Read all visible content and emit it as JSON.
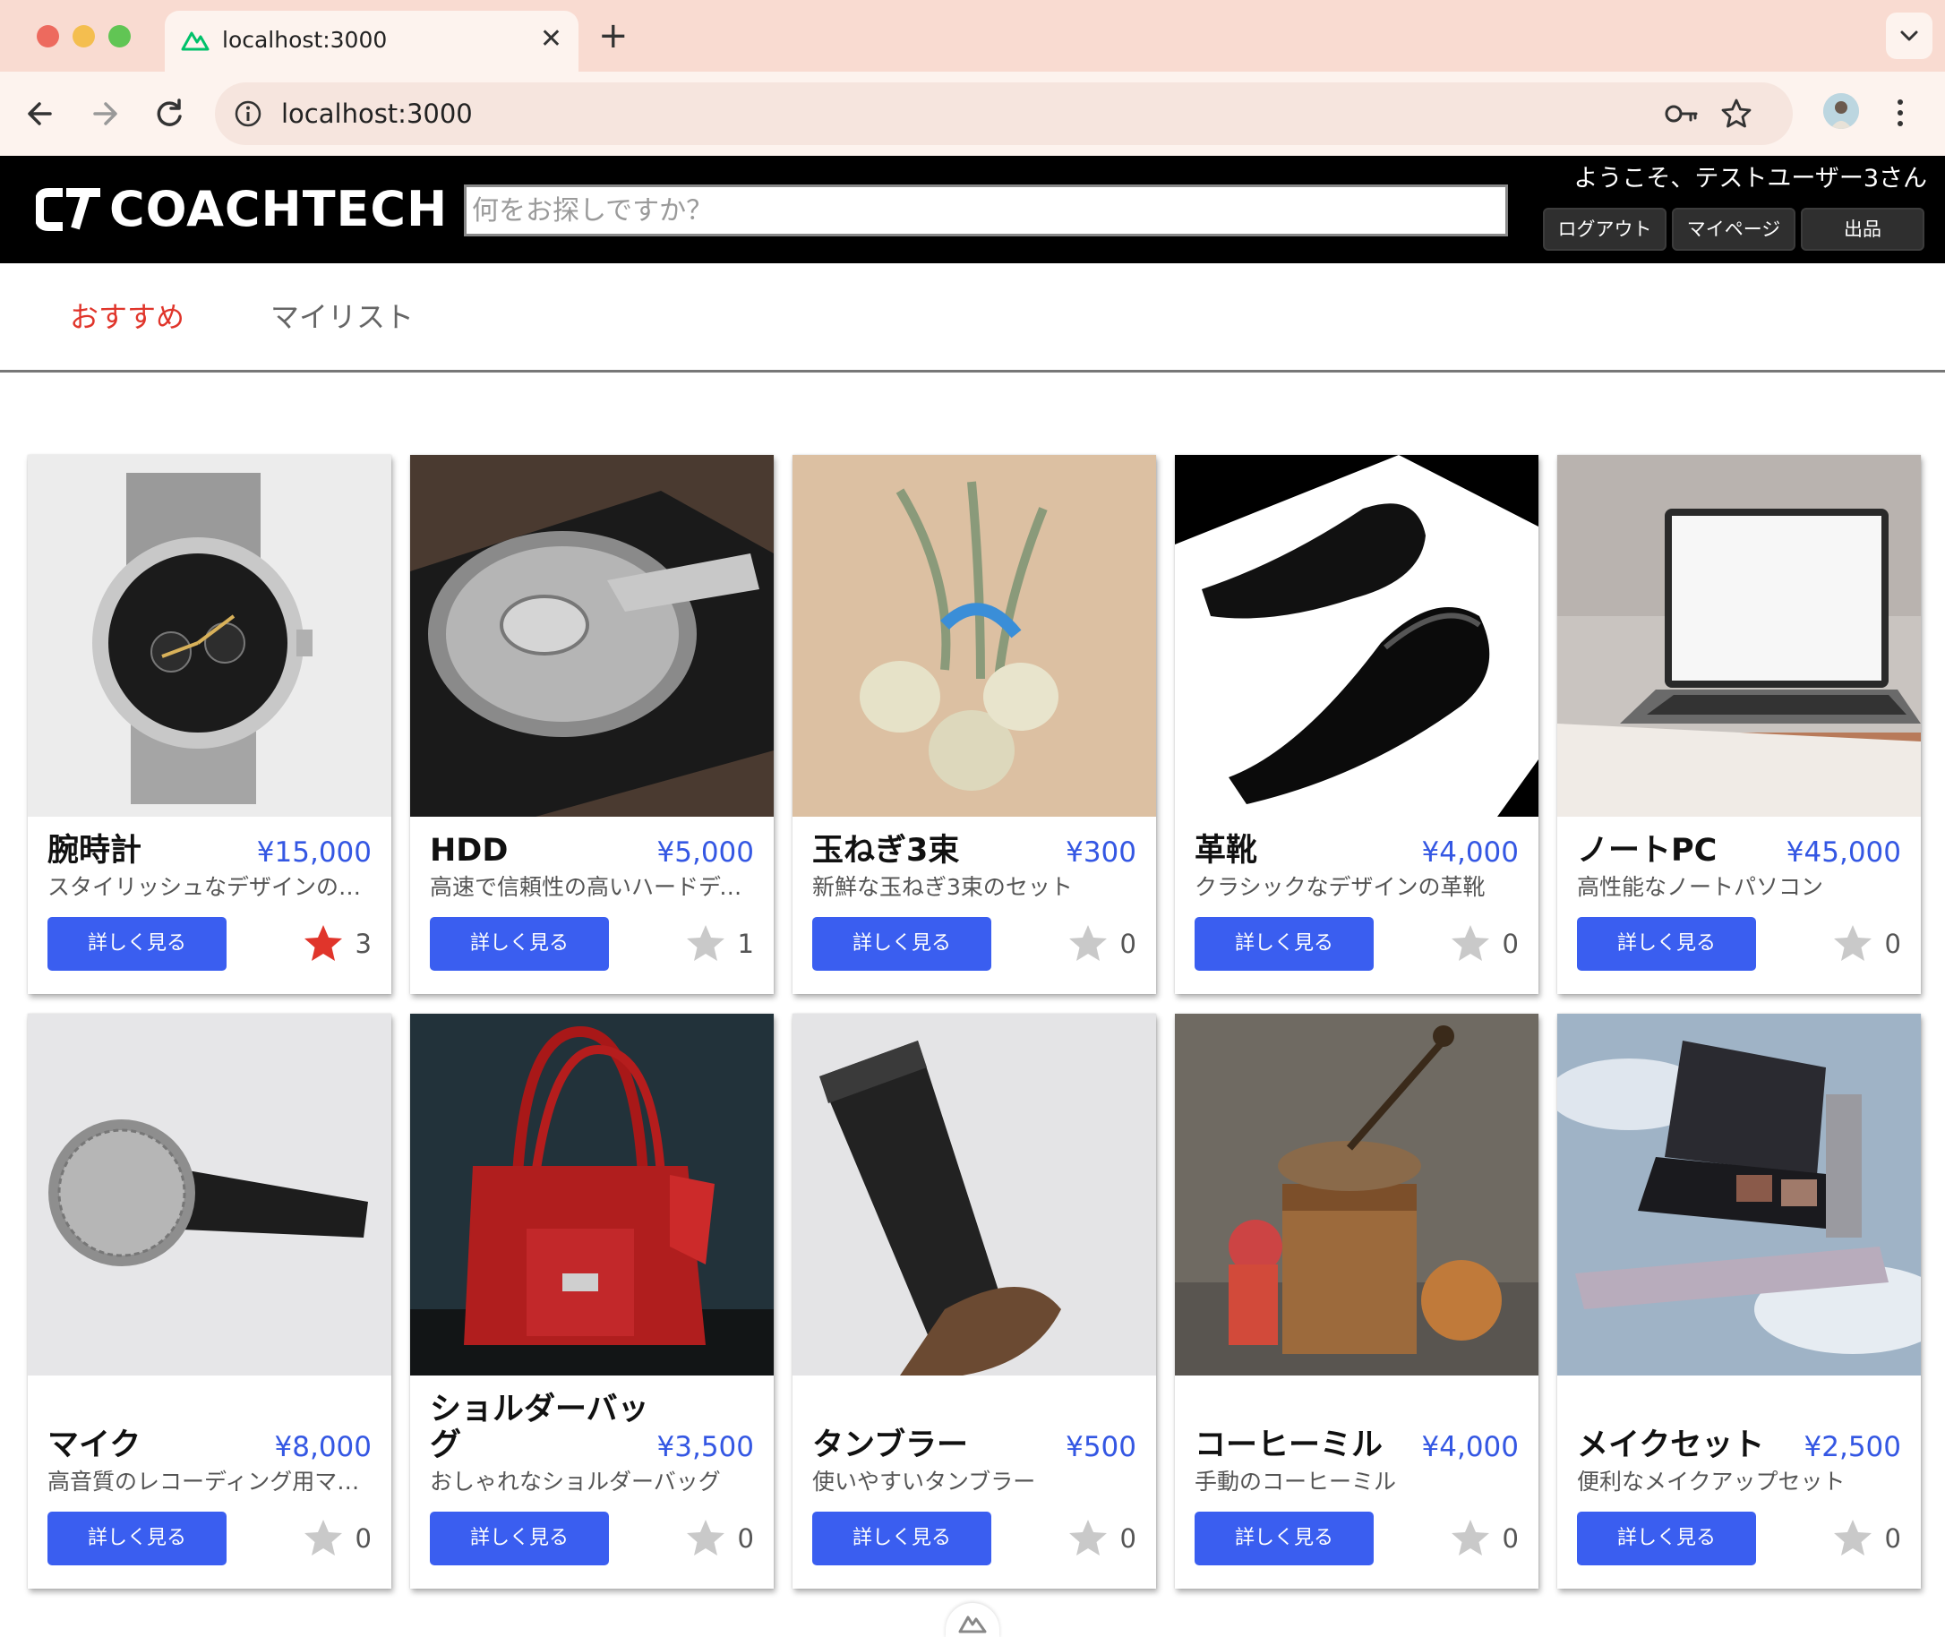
{
  "browser": {
    "tab_title": "localhost:3000",
    "url": "localhost:3000",
    "icons": [
      "nuxt-favicon-icon",
      "close-icon",
      "plus-icon",
      "chevron-down-icon",
      "back-arrow-icon",
      "forward-arrow-icon",
      "reload-icon",
      "info-icon",
      "key-icon",
      "bookmark-star-icon",
      "profile-avatar",
      "kebab-menu-icon"
    ]
  },
  "header": {
    "logo_text": "COACHTECH",
    "search_placeholder": "何をお探しですか？",
    "welcome": "ようこそ、テストユーザー3さん",
    "logout": "ログアウト",
    "mypage": "マイページ",
    "sell": "出品"
  },
  "tabs": {
    "recommended": "おすすめ",
    "mylist": "マイリスト"
  },
  "colors": {
    "accent_red": "#e0352b",
    "price_blue": "#3457e3",
    "button_blue": "#3a5ef0",
    "header_bg": "#000000"
  },
  "items": [
    {
      "name": "腕時計",
      "price": "¥15,000",
      "desc": "スタイリッシュなデザインのメンズ腕時計",
      "button": "詳しく見る",
      "likes": "3",
      "liked": true
    },
    {
      "name": "HDD",
      "price": "¥5,000",
      "desc": "高速で信頼性の高いハードディスク",
      "button": "詳しく見る",
      "likes": "1",
      "liked": false
    },
    {
      "name": "玉ねぎ3束",
      "price": "¥300",
      "desc": "新鮮な玉ねぎ3束のセット",
      "button": "詳しく見る",
      "likes": "0",
      "liked": false
    },
    {
      "name": "革靴",
      "price": "¥4,000",
      "desc": "クラシックなデザインの革靴",
      "button": "詳しく見る",
      "likes": "0",
      "liked": false
    },
    {
      "name": "ノートPC",
      "price": "¥45,000",
      "desc": "高性能なノートパソコン",
      "button": "詳しく見る",
      "likes": "0",
      "liked": false
    },
    {
      "name": "マイク",
      "price": "¥8,000",
      "desc": "高音質のレコーディング用マイク",
      "button": "詳しく見る",
      "likes": "0",
      "liked": false
    },
    {
      "name": "ショルダーバッグ",
      "price": "¥3,500",
      "desc": "おしゃれなショルダーバッグ",
      "button": "詳しく見る",
      "likes": "0",
      "liked": false
    },
    {
      "name": "タンブラー",
      "price": "¥500",
      "desc": "使いやすいタンブラー",
      "button": "詳しく見る",
      "likes": "0",
      "liked": false
    },
    {
      "name": "コーヒーミル",
      "price": "¥4,000",
      "desc": "手動のコーヒーミル",
      "button": "詳しく見る",
      "likes": "0",
      "liked": false
    },
    {
      "name": "メイクセット",
      "price": "¥2,500",
      "desc": "便利なメイクアップセット",
      "button": "詳しく見る",
      "likes": "0",
      "liked": false
    }
  ]
}
